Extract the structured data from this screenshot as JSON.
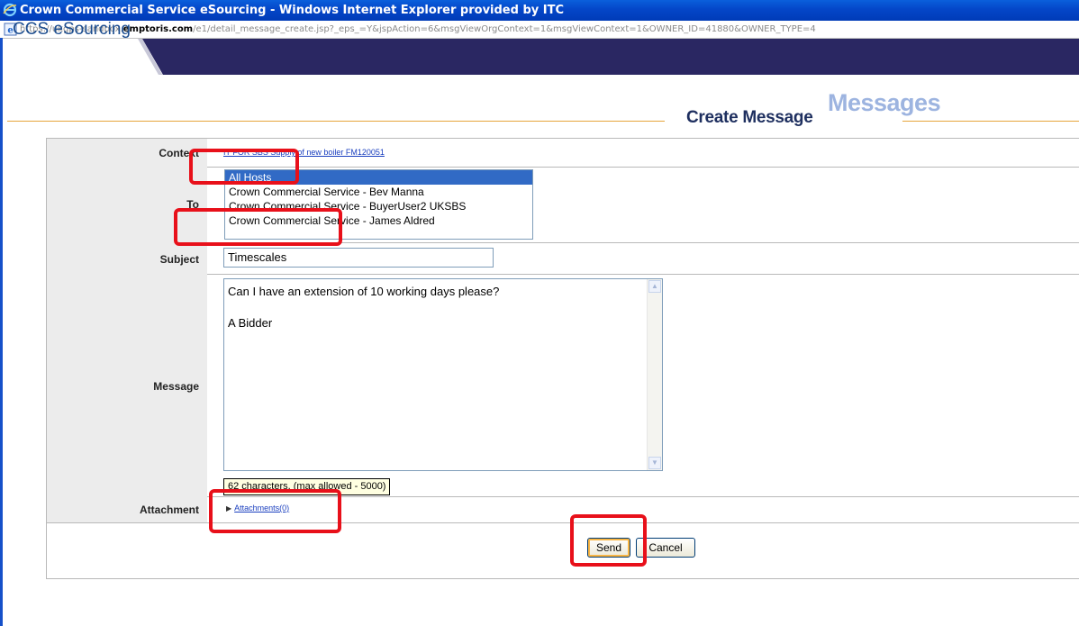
{
  "window": {
    "title": "Crown Commercial Service eSourcing - Windows Internet Explorer provided by ITC",
    "url_prefix": "https://ukgps-sandbox.",
    "url_domain": "emptoris.com",
    "url_path": "/e1/detail_message_create.jsp?_eps_=Y&jspAction=6&msgViewOrgContext=1&msgViewContext=1&OWNER_ID=41880&OWNER_TYPE=4"
  },
  "header": {
    "app_name": "CCS eSourcing",
    "section_title": "Messages",
    "page_title": "Create Message",
    "accent_color": "#2a2762"
  },
  "form": {
    "context": {
      "label": "Context",
      "value": "IT FOR SBS Supply of new boiler FM120051"
    },
    "to": {
      "label": "To",
      "options": [
        "All Hosts",
        "Crown Commercial Service - Bev Manna",
        "Crown Commercial Service - BuyerUser2 UKSBS",
        "Crown Commercial Service - James Aldred"
      ],
      "selected": "All Hosts"
    },
    "subject": {
      "label": "Subject",
      "value": "Timescales"
    },
    "message": {
      "label": "Message",
      "line1": "Can I have an extension of 10 working days please?",
      "line2": "A Bidder",
      "char_count": "62 characters, (max allowed - 5000)"
    },
    "attachment": {
      "label": "Attachment",
      "link": "Attachments(0)"
    },
    "actions": {
      "send": "Send",
      "cancel": "Cancel"
    }
  }
}
